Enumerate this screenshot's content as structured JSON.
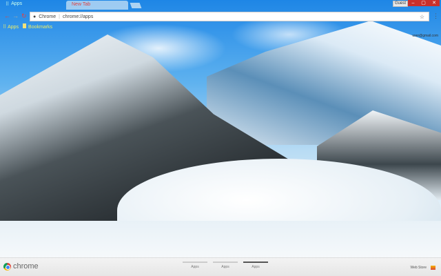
{
  "window": {
    "tab_title": "New Tab",
    "apps_tab": "Apps",
    "user_button": "Guest",
    "controls": [
      "–",
      "▢",
      "✕"
    ]
  },
  "toolbar": {
    "site_label": "Chrome",
    "url": "chrome://apps"
  },
  "bookmarks": {
    "apps": "Apps",
    "bookmarks": "Bookmarks"
  },
  "account": {
    "email": "user@gmail.com"
  },
  "footer": {
    "brand": "chrome",
    "pages": [
      "Apps",
      "Apps",
      "Apps"
    ],
    "active_page": 2,
    "web_store": "Web Store"
  }
}
